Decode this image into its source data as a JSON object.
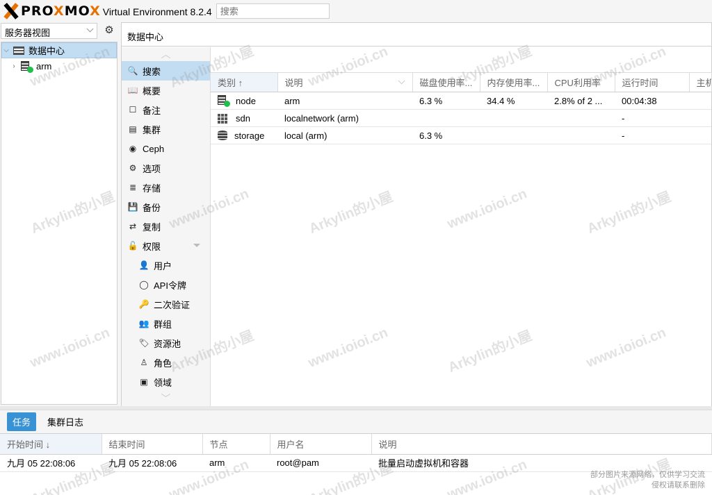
{
  "header": {
    "logo_prox": "PRO",
    "logo_x": "X",
    "logo_mo": "MO",
    "logo_x2": "X",
    "version": "Virtual Environment 8.2.4",
    "search_placeholder": "搜索"
  },
  "sidebar": {
    "view_select": "服务器视图",
    "tree": [
      {
        "label": "数据中心",
        "level": 0,
        "selected": true
      },
      {
        "label": "arm",
        "level": 1,
        "selected": false
      }
    ]
  },
  "main": {
    "title": "数据中心",
    "menu": [
      {
        "label": "搜索",
        "icon": "search-icon",
        "glyph": "🔍",
        "active": true,
        "sub": false
      },
      {
        "label": "概要",
        "icon": "book-icon",
        "glyph": "📖",
        "active": false,
        "sub": false
      },
      {
        "label": "备注",
        "icon": "note-icon",
        "glyph": "☐",
        "active": false,
        "sub": false
      },
      {
        "label": "集群",
        "icon": "server-icon",
        "glyph": "▤",
        "active": false,
        "sub": false
      },
      {
        "label": "Ceph",
        "icon": "ceph-icon",
        "glyph": "◉",
        "active": false,
        "sub": false
      },
      {
        "label": "选项",
        "icon": "gear-icon",
        "glyph": "⚙",
        "active": false,
        "sub": false
      },
      {
        "label": "存储",
        "icon": "database-icon",
        "glyph": "≣",
        "active": false,
        "sub": false
      },
      {
        "label": "备份",
        "icon": "floppy-icon",
        "glyph": "💾",
        "active": false,
        "sub": false
      },
      {
        "label": "复制",
        "icon": "retweet-icon",
        "glyph": "⇄",
        "active": false,
        "sub": false
      },
      {
        "label": "权限",
        "icon": "unlock-icon",
        "glyph": "🔓",
        "active": false,
        "sub": false
      },
      {
        "label": "用户",
        "icon": "user-icon",
        "glyph": "👤",
        "active": false,
        "sub": true
      },
      {
        "label": "API令牌",
        "icon": "user-outline-icon",
        "glyph": "◯",
        "active": false,
        "sub": true
      },
      {
        "label": "二次验证",
        "icon": "key-icon",
        "glyph": "🔑",
        "active": false,
        "sub": true
      },
      {
        "label": "群组",
        "icon": "users-icon",
        "glyph": "👥",
        "active": false,
        "sub": true
      },
      {
        "label": "资源池",
        "icon": "tags-icon",
        "glyph": "🏷",
        "active": false,
        "sub": true
      },
      {
        "label": "角色",
        "icon": "male-icon",
        "glyph": "♙",
        "active": false,
        "sub": true
      },
      {
        "label": "领域",
        "icon": "address-book-icon",
        "glyph": "▣",
        "active": false,
        "sub": true
      }
    ],
    "grid": {
      "columns": [
        "类别",
        "说明",
        "磁盘使用率...",
        "内存使用率...",
        "CPU利用率",
        "运行时间",
        "主机"
      ],
      "rows": [
        {
          "type": "node",
          "desc": "arm",
          "disk": "6.3 %",
          "mem": "34.4 %",
          "cpu": "2.8% of 2 ...",
          "uptime": "00:04:38",
          "host": ""
        },
        {
          "type": "sdn",
          "desc": "localnetwork (arm)",
          "disk": "",
          "mem": "",
          "cpu": "",
          "uptime": "-",
          "host": ""
        },
        {
          "type": "storage",
          "desc": "local (arm)",
          "disk": "6.3 %",
          "mem": "",
          "cpu": "",
          "uptime": "-",
          "host": ""
        }
      ]
    }
  },
  "tasks": {
    "tabs": [
      "任务",
      "集群日志"
    ],
    "columns": [
      "开始时间",
      "结束时间",
      "节点",
      "用户名",
      "说明"
    ],
    "rows": [
      {
        "start": "九月 05 22:08:06",
        "end": "九月 05 22:08:06",
        "node": "arm",
        "user": "root@pam",
        "desc": "批量启动虚拟机和容器"
      }
    ]
  },
  "watermark": {
    "site": "www.ioioi.cn",
    "name": "Arkylin的小屋",
    "notice_line1": "部分图片来源网络，仅供学习交流",
    "notice_line2": "侵权请联系删除"
  },
  "colors": {
    "accent": "#3892d4",
    "selected": "#c2ddf2",
    "logo_orange": "#e57000",
    "ok_green": "#21bf4b"
  }
}
